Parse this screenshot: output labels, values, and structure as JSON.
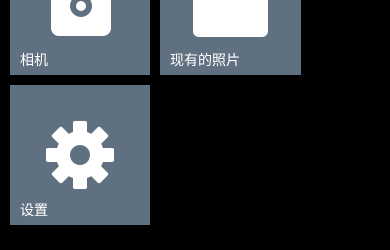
{
  "tiles": {
    "camera": {
      "label": "相机",
      "icon": "camera-icon"
    },
    "photos": {
      "label": "现有的照片",
      "icon": "photo-icon"
    },
    "settings": {
      "label": "设置",
      "icon": "gear-icon"
    }
  },
  "colors": {
    "background": "#000000",
    "tile": "#5f7181",
    "foreground": "#ffffff"
  }
}
